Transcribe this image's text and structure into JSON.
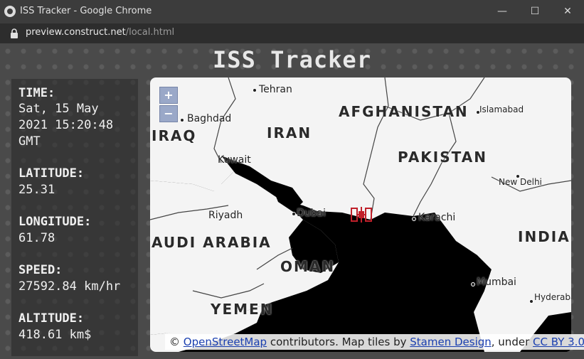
{
  "window": {
    "title": "ISS Tracker - Google Chrome",
    "url_host": "preview.construct.net",
    "url_path": "/local.html"
  },
  "page": {
    "title": "ISS Tracker"
  },
  "info": {
    "time_label": "TIME:",
    "time_value": "Sat, 15 May\n2021 15:20:48\nGMT",
    "latitude_label": "LATITUDE:",
    "latitude_value": "25.31",
    "longitude_label": "LONGITUDE:",
    "longitude_value": "61.78",
    "speed_label": "SPEED:",
    "speed_value": "27592.84 km/hr",
    "altitude_label": "ALTITUDE:",
    "altitude_value": "418.61 km$"
  },
  "map": {
    "zoom_in": "+",
    "zoom_out": "−",
    "countries": {
      "afghanistan": "AFGHANISTAN",
      "iran": "IRAN",
      "iraq": "IRAQ",
      "pakistan": "PAKISTAN",
      "india": "INDIA",
      "saudi_arabia": "AUDI ARABIA",
      "oman": "OMAN",
      "yemen": "YEMEN"
    },
    "cities": {
      "tehran": "Tehran",
      "baghdad": "Baghdad",
      "kuwait": "Kuwait",
      "islamabad": "Islamabad",
      "new_delhi": "New Delhi",
      "riyadh": "Riyadh",
      "dubai": "Dubai",
      "karachi": "Karachi",
      "mumbai": "Mumbai",
      "hyderabad": "Hyderaba"
    },
    "attribution": {
      "prefix": "©",
      "osm_link": "OpenStreetMap",
      "middle": "contributors. Map tiles by",
      "stamen_link": "Stamen Design",
      "under": ", under",
      "license_link": "CC BY 3.0",
      "suffix": "."
    },
    "iss_icon": "satellite-icon"
  }
}
